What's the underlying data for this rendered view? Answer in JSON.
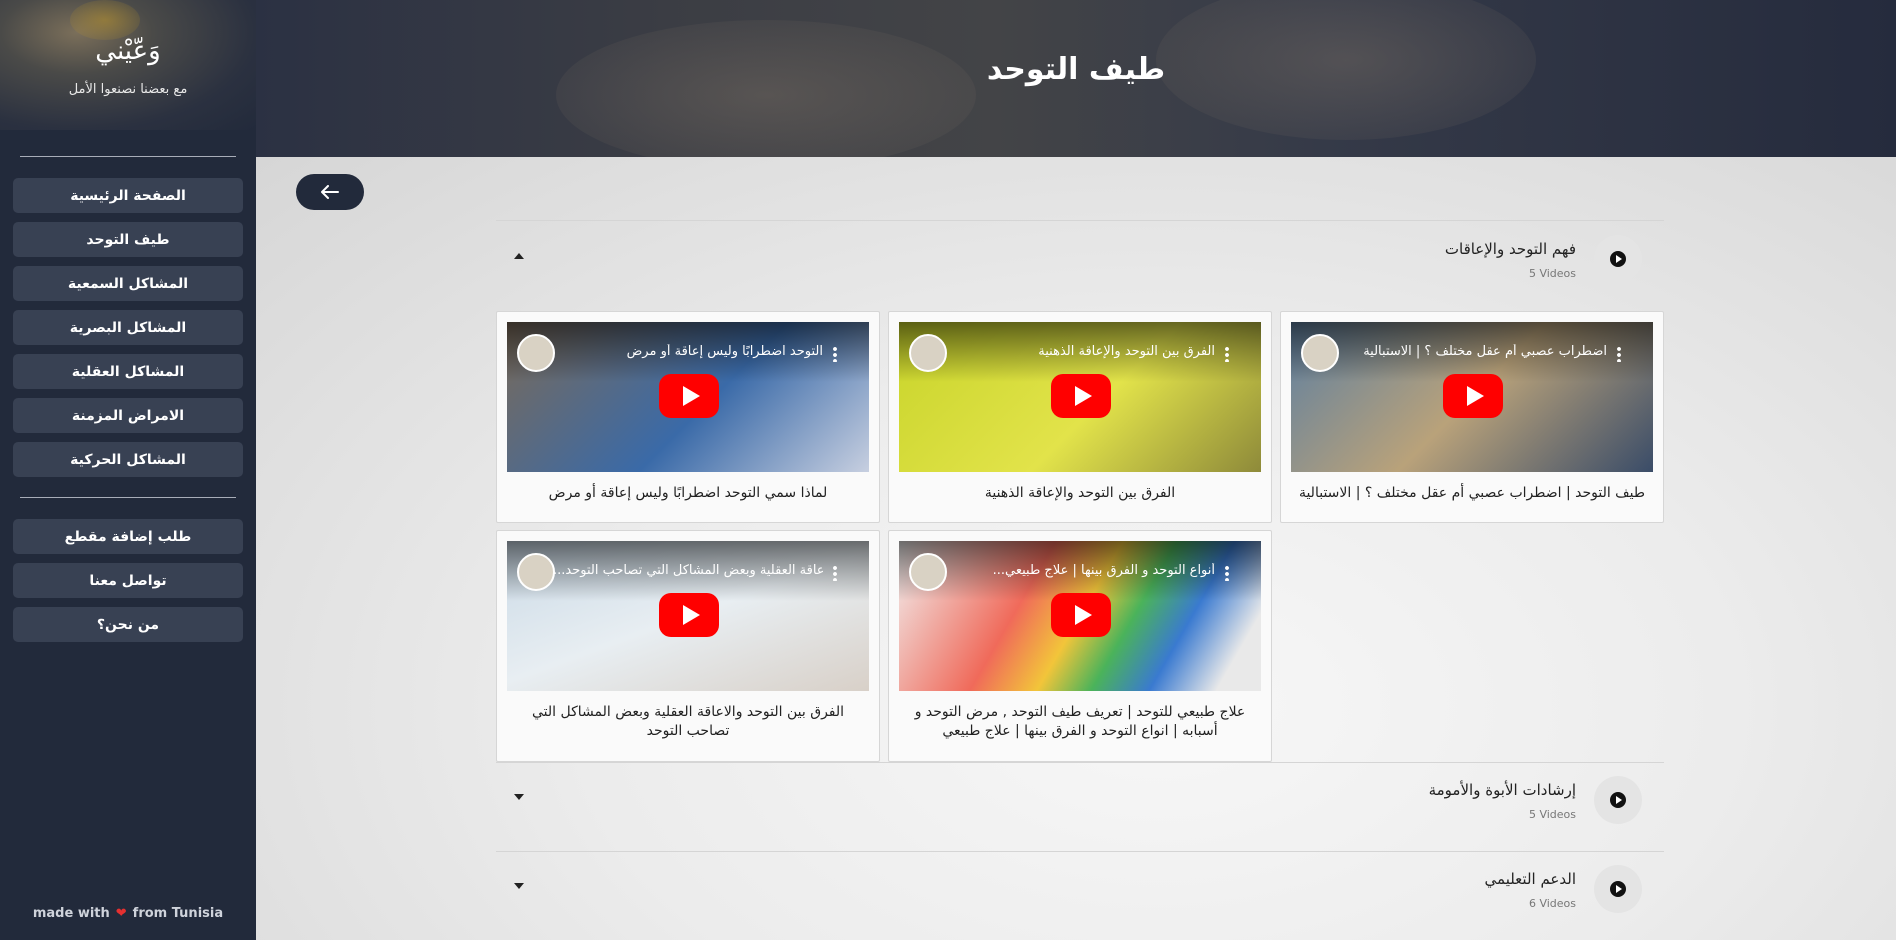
{
  "sidebar": {
    "brand": "وَعّيْني",
    "tagline": "مع بعضنا نصنعوا الأمل",
    "nav": [
      {
        "label": "الصفحة الرئيسية"
      },
      {
        "label": "طيف التوحد"
      },
      {
        "label": "المشاكل السمعية"
      },
      {
        "label": "المشاكل البصرية"
      },
      {
        "label": "المشاكل العقلية"
      },
      {
        "label": "الامراض المزمنة"
      },
      {
        "label": "المشاكل الحركية"
      }
    ],
    "secondary": [
      {
        "label": "طلب إضافة مقطع"
      },
      {
        "label": "تواصل معنا"
      },
      {
        "label": "من نحن؟"
      }
    ],
    "footer": {
      "made_with": "made with",
      "from": "from Tunisia"
    }
  },
  "header": {
    "title": "طيف التوحد"
  },
  "main": {
    "back_icon": "arrow-left-icon",
    "sections": [
      {
        "title": "فهم التوحد والإعاقات",
        "count": "5 Videos",
        "expanded": true,
        "videos": [
          {
            "overlay_title": "اضطراب عصبي أم عقل مختلف ؟ | الاستبالية",
            "caption": "طيف التوحد | اضطراب عصبي أم عقل مختلف ؟ | الاستبالية",
            "thumb_color": "#5e7fa0"
          },
          {
            "overlay_title": "الفرق بين التوحد والإعاقة الذهنية",
            "caption": "الفرق بين التوحد والإعاقة الذهنية",
            "thumb_color": "#c8d42a"
          },
          {
            "overlay_title": "التوحد اضطرابًا وليس إعاقة أو مرض",
            "caption": "لماذا سمي التوحد اضطرابًا وليس إعاقة أو مرض",
            "thumb_color": "#3a6aa8"
          },
          {
            "overlay_title": "...أنواع التوحد و الفرق بينها | علاج طبيعي",
            "caption": "علاج طبيعي للتوحد | تعريف طيف التوحد , مرض التوحد و أسبابه | انواع التوحد و الفرق بينها | علاج طبيعي",
            "thumb_color": "#e9e9e9"
          },
          {
            "overlay_title": "...الفرق بين التوحد والاعاقة العقلية وبعض المشاكل التي تصاحب التوحد",
            "caption": "الفرق بين التوحد والاعاقة العقلية وبعض المشاكل التي تصاحب التوحد",
            "thumb_color": "#c9d9e6"
          }
        ]
      },
      {
        "title": "إرشادات الأبوة والأمومة",
        "count": "5 Videos",
        "expanded": false
      },
      {
        "title": "الدعم التعليمي",
        "count": "6 Videos",
        "expanded": false
      }
    ]
  }
}
